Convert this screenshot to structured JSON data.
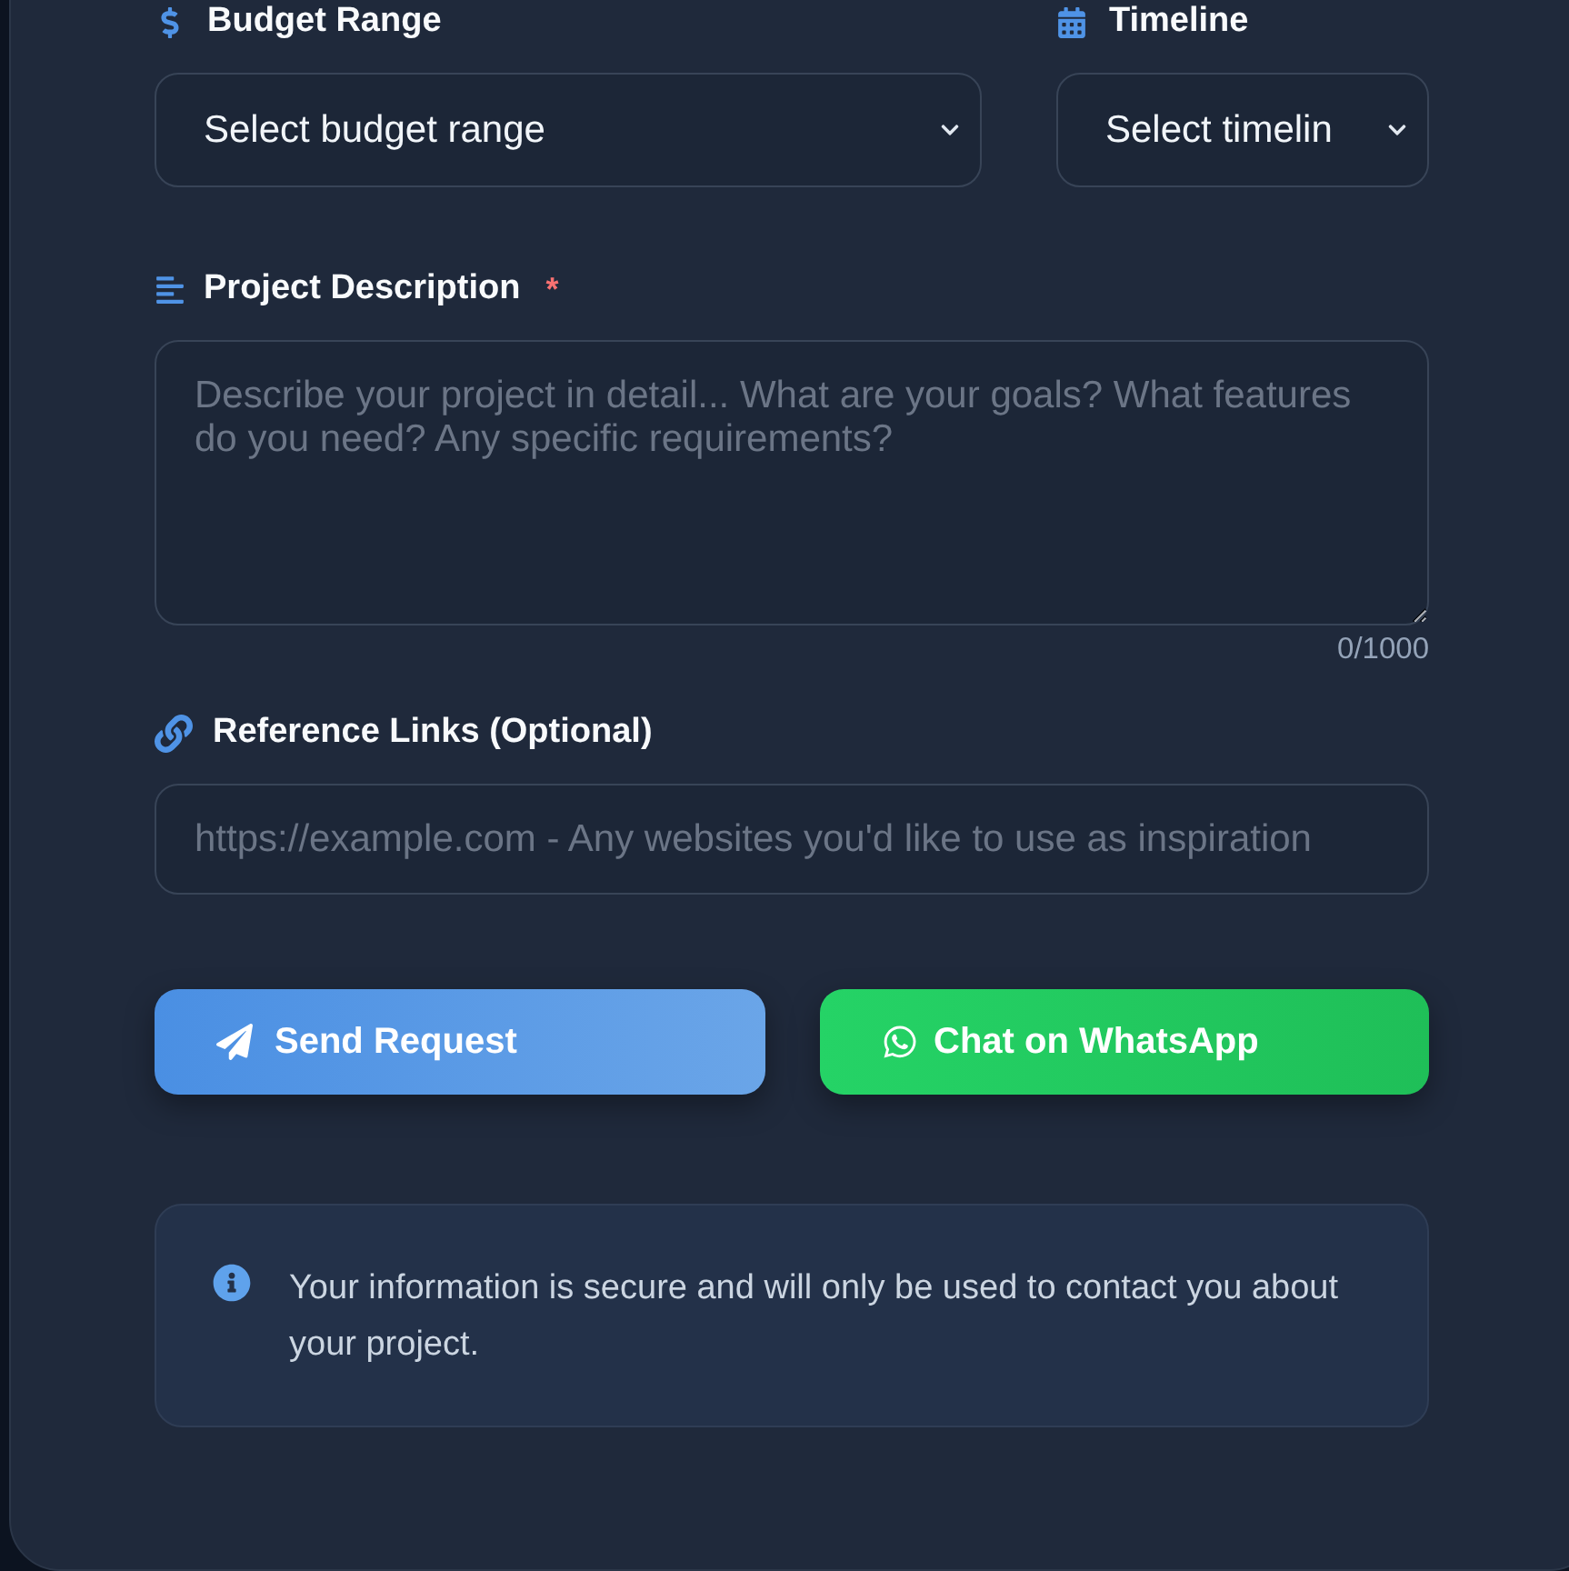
{
  "budget_range": {
    "label": "Budget Range",
    "value": "Select budget range"
  },
  "timeline": {
    "label": "Timeline",
    "value": "Select timelin"
  },
  "project_description": {
    "label": "Project Description",
    "required_mark": "*",
    "placeholder": "Describe your project in detail... What are your goals? What features do you need? Any specific requirements?",
    "counter": "0/1000"
  },
  "reference_links": {
    "label": "Reference Links (Optional)",
    "placeholder": "https://example.com - Any websites you'd like to use as inspiration"
  },
  "buttons": [
    {
      "kind": "send",
      "label": "Send Request"
    },
    {
      "kind": "whatsapp",
      "label": "Chat on WhatsApp"
    }
  ],
  "notice": {
    "text": "Your information is secure and will only be used to contact you about your project."
  }
}
